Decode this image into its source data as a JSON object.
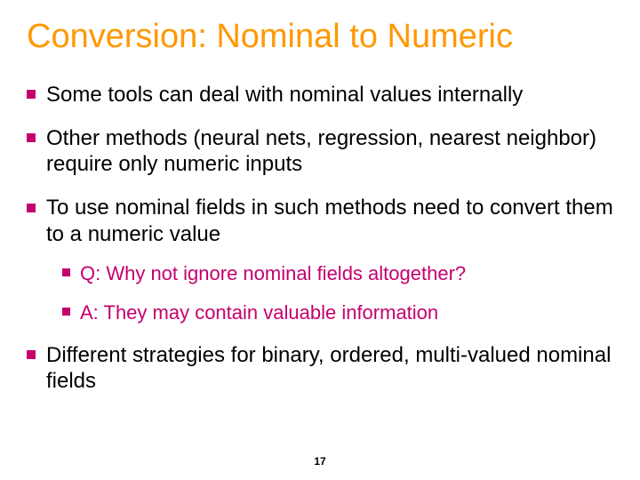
{
  "slide": {
    "title": "Conversion: Nominal to Numeric",
    "bullets": [
      {
        "text": "Some tools can deal with nominal values internally"
      },
      {
        "text": "Other methods (neural nets, regression, nearest neighbor) require only numeric inputs"
      },
      {
        "text": "To use nominal fields in such methods need to convert them to a numeric value",
        "sub": [
          {
            "text": "Q: Why not ignore nominal fields altogether?"
          },
          {
            "text": "A: They may contain valuable information"
          }
        ]
      },
      {
        "text": "Different strategies for binary, ordered, multi-valued nominal fields"
      }
    ],
    "page_number": "17"
  }
}
